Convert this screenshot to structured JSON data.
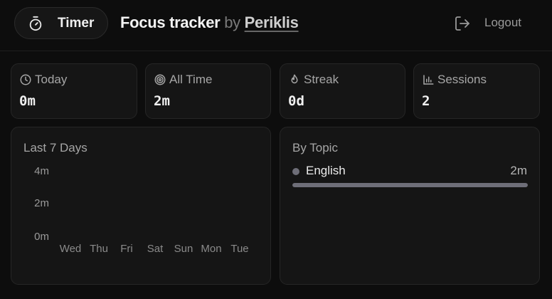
{
  "header": {
    "timer_label": "Timer",
    "title": "Focus tracker",
    "by": "by",
    "author": "Periklis",
    "logout_label": "Logout"
  },
  "stats": [
    {
      "label": "Today",
      "value": "0m",
      "icon": "clock-icon"
    },
    {
      "label": "All Time",
      "value": "2m",
      "icon": "target-icon"
    },
    {
      "label": "Streak",
      "value": "0d",
      "icon": "flame-icon"
    },
    {
      "label": "Sessions",
      "value": "2",
      "icon": "bar-chart-icon"
    }
  ],
  "weekly": {
    "title": "Last 7 Days"
  },
  "chart_data": {
    "type": "bar",
    "categories": [
      "Wed",
      "Thu",
      "Fri",
      "Sat",
      "Sun",
      "Mon",
      "Tue"
    ],
    "values": [
      0,
      0,
      0,
      0,
      0,
      0,
      0
    ],
    "y_tick_labels": [
      "4m",
      "2m",
      "0m"
    ],
    "ylim": [
      0,
      4
    ]
  },
  "topics": {
    "title": "By Topic",
    "items": [
      {
        "name": "English",
        "value": "2m",
        "share": 1.0,
        "color": "#6e6e78"
      }
    ]
  }
}
